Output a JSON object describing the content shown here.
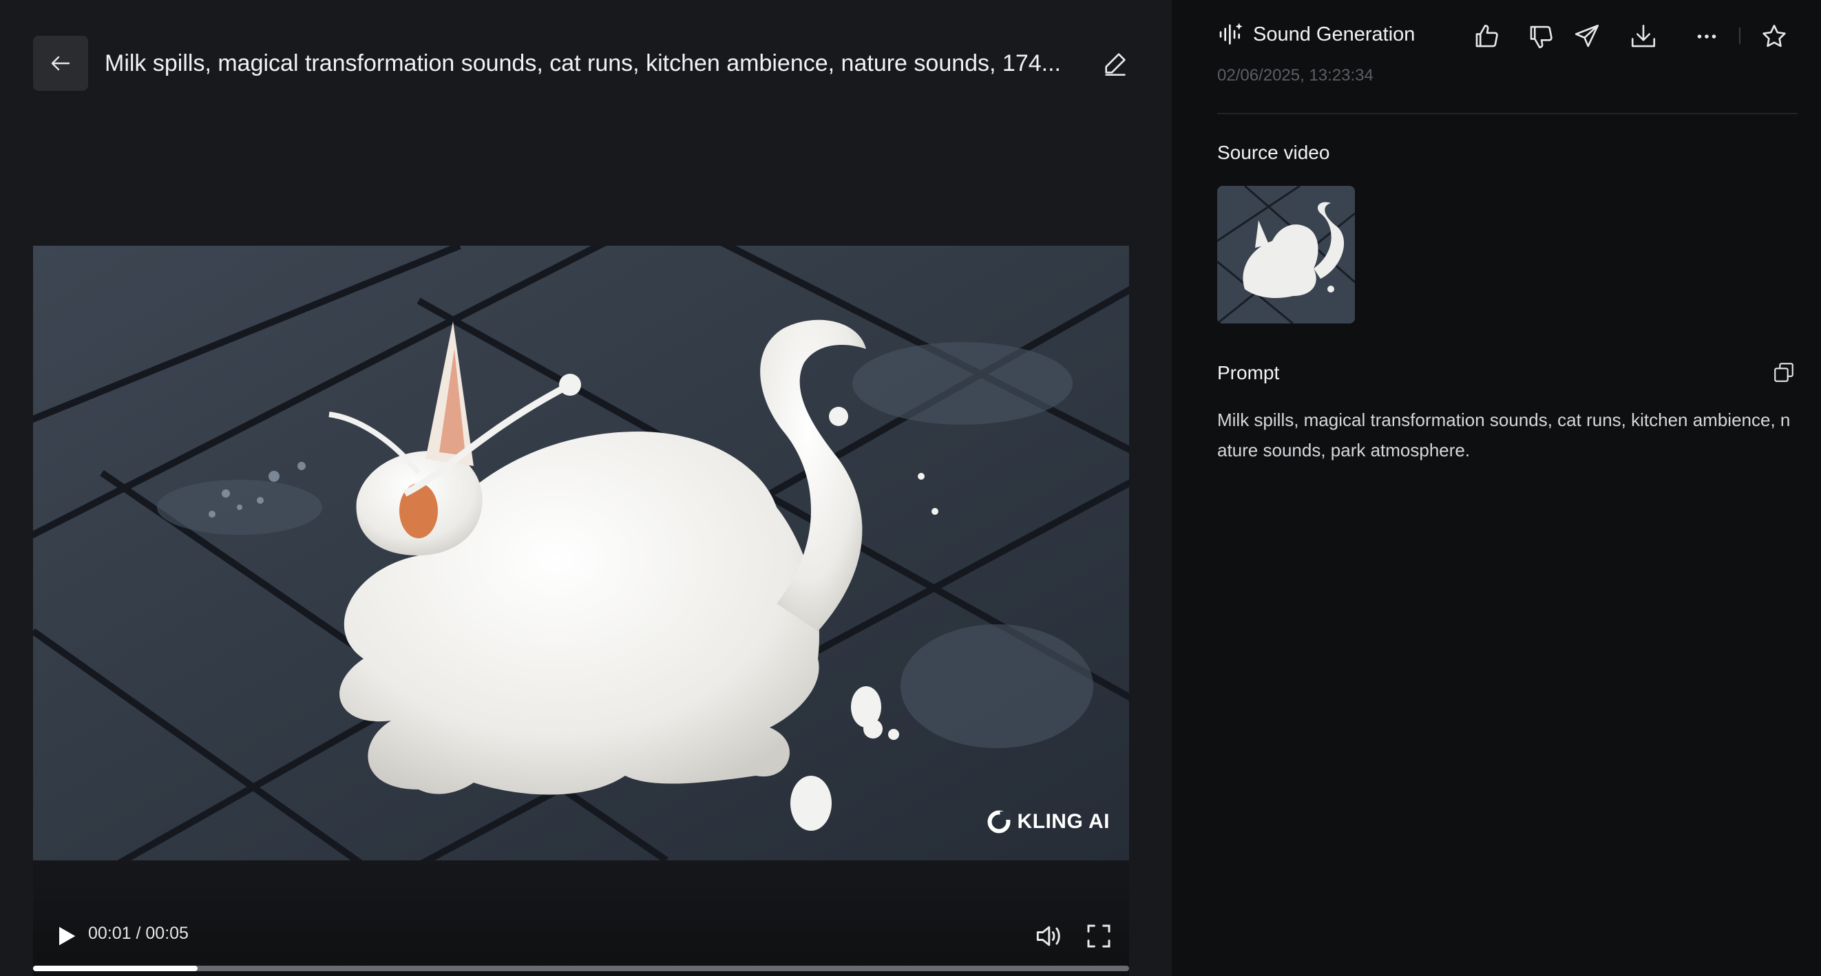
{
  "header": {
    "title": "Milk spills, magical transformation sounds, cat runs, kitchen ambience, nature sounds, 174...",
    "back_icon": "arrow-left-icon",
    "edit_icon": "pencil-icon"
  },
  "video": {
    "watermark": "KLING AI",
    "current_time": "00:01",
    "duration": "00:05",
    "time_display": "00:01 / 00:05",
    "progress": 0.15
  },
  "sidebar": {
    "mode_icon": "sound-wave-icon",
    "mode_label": "Sound Generation",
    "actions": [
      "thumbs-up-icon",
      "thumbs-down-icon",
      "share-icon",
      "download-icon",
      "more-icon",
      "star-icon"
    ],
    "timestamp": "02/06/2025, 13:23:34",
    "source_video_label": "Source video",
    "prompt_label": "Prompt",
    "prompt_text": "Milk spills, magical transformation sounds, cat runs, kitchen ambience, nature sounds, park atmosphere."
  },
  "colors": {
    "left_bg": "#18191c",
    "right_bg": "#0e0f11",
    "accent_text": "#f4f4f6",
    "muted_text": "#5d5e63"
  }
}
